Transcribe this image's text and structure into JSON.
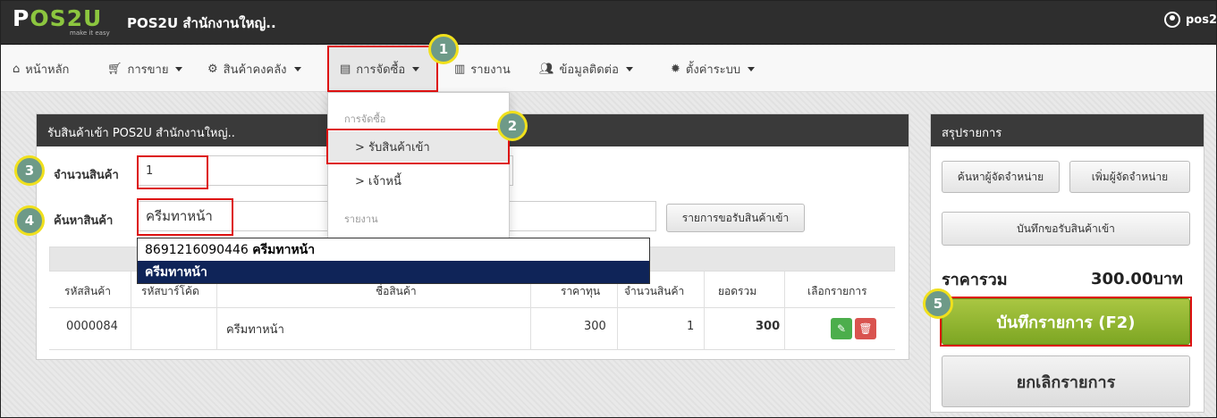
{
  "header": {
    "logo_text_a": "P",
    "logo_text_b": "OS2U",
    "logo_tagline": "make it easy",
    "app_title": "POS2U สำนักงานใหญ่..",
    "user_label": "pos2"
  },
  "nav": {
    "home": "หน้าหลัก",
    "sales": "การขาย",
    "inventory": "สินค้าคงคลัง",
    "purchasing": "การจัดซื้อ",
    "report": "รายงาน",
    "contacts": "ข้อมูลติดต่อ",
    "settings": "ตั้งค่าระบบ"
  },
  "dropdown": {
    "section_purchasing": "การจัดซื้อ",
    "item_receive": "> รับสินค้าเข้า",
    "item_creditor": "> เจ้าหนี้",
    "section_report": "รายงาน"
  },
  "main_panel": {
    "title": "รับสินค้าเข้า POS2U สำนักงานใหญ่..",
    "qty_label": "จำนวนสินค้า",
    "qty_value": "1",
    "search_label": "ค้นหาสินค้า",
    "search_value": "ครีมทาหน้า",
    "request_list_button": "รายการขอรับสินค้าเข้า"
  },
  "autocomplete": {
    "item1_code": "8691216090446",
    "item1_name": "ครีมทาหน้า",
    "item2_name": "ครีมทาหน้า"
  },
  "table": {
    "headers": [
      "รหัสสินค้า",
      "รหัสบาร์โค้ด",
      "ชื่อสินค้า",
      "ราคาทุน",
      "จำนวนสินค้า",
      "ยอดรวม",
      "เลือกรายการ"
    ],
    "rows": [
      {
        "code": "0000084",
        "barcode": "",
        "name": "ครีมทาหน้า",
        "cost": "300",
        "qty": "1",
        "total": "300"
      }
    ]
  },
  "summary": {
    "title": "สรุปรายการ",
    "find_supplier": "ค้นหาผู้จัดจำหน่าย",
    "add_supplier": "เพิ่มผู้จัดจำหน่าย",
    "save_request": "บันทึกขอรับสินค้าเข้า",
    "total_label": "ราคารวม",
    "total_value": "300.00บาท",
    "save_button": "บันทึกรายการ (F2)",
    "cancel_button": "ยกเลิกรายการ"
  },
  "steps": [
    "1",
    "2",
    "3",
    "4",
    "5"
  ],
  "colors": {
    "topbar": "#2e2e2e",
    "highlight_red": "#dd1111",
    "badge_fill": "#6e9a88",
    "badge_ring": "#f0e01c",
    "save_green": "#8db52e",
    "autocomplete_selected": "#0f2458",
    "edit_green": "#4cae4c",
    "delete_red": "#d9534f"
  },
  "icons": [
    "home-icon",
    "cart-icon",
    "boxes-icon",
    "document-icon",
    "bar-chart-icon",
    "users-icon",
    "gear-icon",
    "user-circle-icon",
    "edit-icon",
    "trash-icon"
  ]
}
